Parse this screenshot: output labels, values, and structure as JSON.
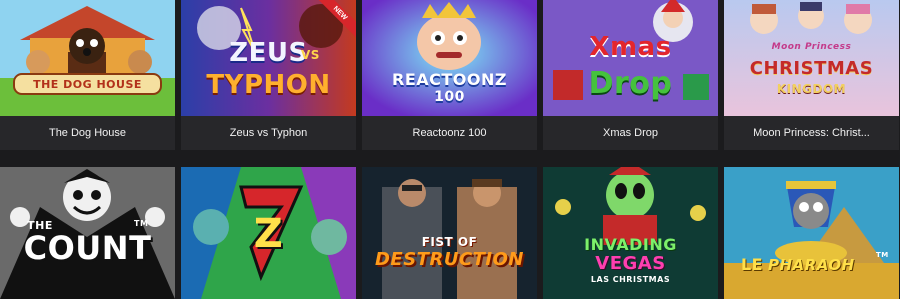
{
  "games": [
    {
      "title": "The Dog House",
      "logo": [
        "THE DOG HOUSE"
      ]
    },
    {
      "title": "Zeus vs Typhon",
      "logo": [
        "ZEUS",
        "VS",
        "TYPHON"
      ],
      "badge": "NEW"
    },
    {
      "title": "Reactoonz 100",
      "logo": [
        "REACTOONZ",
        "100"
      ]
    },
    {
      "title": "Xmas Drop",
      "logo": [
        "Xmas",
        "Drop"
      ]
    },
    {
      "title": "Moon Princess: Christ...",
      "logo": [
        "Moon Princess",
        "CHRISTMAS",
        "KINGDOM"
      ]
    },
    {
      "logo": [
        "THE",
        "COUNT",
        "TM"
      ]
    },
    {
      "logo": [
        "Z"
      ]
    },
    {
      "logo": [
        "FIST OF",
        "DESTRUCTION"
      ]
    },
    {
      "logo": [
        "INVADING",
        "VEGAS",
        "LAS CHRISTMAS"
      ]
    },
    {
      "logo": [
        "LE",
        "PHARAOH",
        "TM"
      ]
    }
  ],
  "colors": {
    "background": "#1b1b1d",
    "caption_bg": "#27272a",
    "caption_text": "#f2f2f2",
    "new_badge": "#d7262b"
  }
}
